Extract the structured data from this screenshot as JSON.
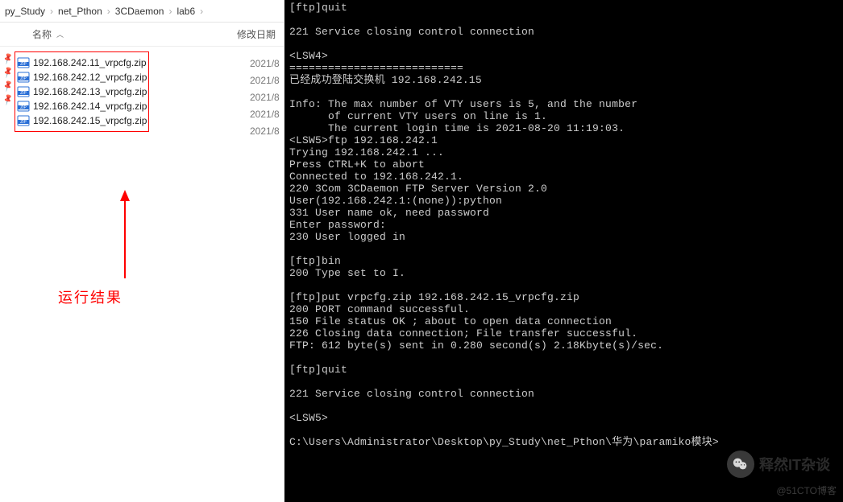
{
  "breadcrumb": {
    "items": [
      "py_Study",
      "net_Pthon",
      "3CDaemon",
      "lab6"
    ]
  },
  "file_header": {
    "name": "名称",
    "date": "修改日期"
  },
  "files": [
    {
      "name": "192.168.242.11_vrpcfg.zip",
      "date": "2021/8"
    },
    {
      "name": "192.168.242.12_vrpcfg.zip",
      "date": "2021/8"
    },
    {
      "name": "192.168.242.13_vrpcfg.zip",
      "date": "2021/8"
    },
    {
      "name": "192.168.242.14_vrpcfg.zip",
      "date": "2021/8"
    },
    {
      "name": "192.168.242.15_vrpcfg.zip",
      "date": "2021/8"
    }
  ],
  "result_label": "运行结果",
  "terminal_text": "[ftp]quit\n\n221 Service closing control connection\n\n<LSW4>\n===========================\n已经成功登陆交换机 192.168.242.15\n\nInfo: The max number of VTY users is 5, and the number\n      of current VTY users on line is 1.\n      The current login time is 2021-08-20 11:19:03.\n<LSW5>ftp 192.168.242.1\nTrying 192.168.242.1 ...\nPress CTRL+K to abort\nConnected to 192.168.242.1.\n220 3Com 3CDaemon FTP Server Version 2.0\nUser(192.168.242.1:(none)):python\n331 User name ok, need password\nEnter password:\n230 User logged in\n\n[ftp]bin\n200 Type set to I.\n\n[ftp]put vrpcfg.zip 192.168.242.15_vrpcfg.zip\n200 PORT command successful.\n150 File status OK ; about to open data connection\n226 Closing data connection; File transfer successful.\nFTP: 612 byte(s) sent in 0.280 second(s) 2.18Kbyte(s)/sec.\n\n[ftp]quit\n\n221 Service closing control connection\n\n<LSW5>\n\nC:\\Users\\Administrator\\Desktop\\py_Study\\net_Pthon\\华为\\paramiko模块>",
  "watermark": {
    "icon": "💬",
    "text": "释然IT杂谈"
  },
  "sub_watermark": "@51CTO博客"
}
